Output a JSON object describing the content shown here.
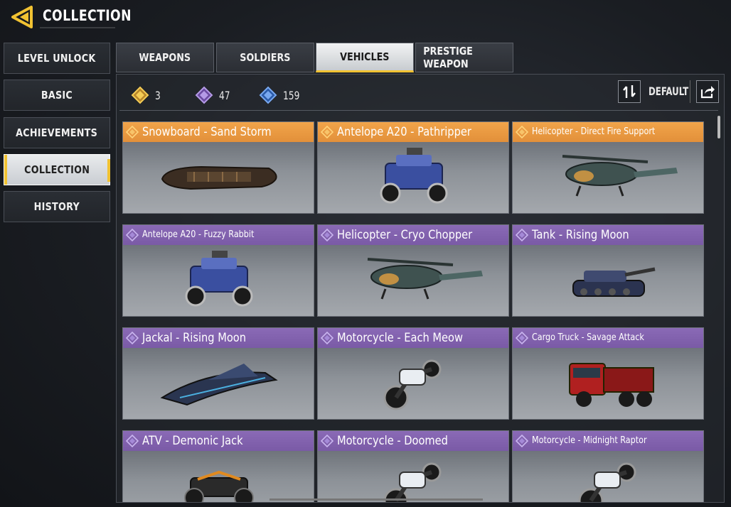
{
  "header": {
    "title": "COLLECTION"
  },
  "menu": [
    {
      "label": "LEVEL UNLOCK",
      "active": false
    },
    {
      "label": "BASIC",
      "active": false
    },
    {
      "label": "ACHIEVEMENTS",
      "active": false
    },
    {
      "label": "COLLECTION",
      "active": true
    },
    {
      "label": "HISTORY",
      "active": false
    }
  ],
  "tabs": [
    {
      "label": "WEAPONS",
      "active": false
    },
    {
      "label": "SOLDIERS",
      "active": false
    },
    {
      "label": "VEHICLES",
      "active": true
    },
    {
      "label": "PRESTIGE WEAPON",
      "active": false
    }
  ],
  "stats": {
    "legendary": {
      "value": "3",
      "color": "#e9b53a"
    },
    "epic": {
      "value": "47",
      "color": "#9b7ad8"
    },
    "rare": {
      "value": "159",
      "color": "#4d82d8"
    }
  },
  "sort": {
    "label": "DEFAULT"
  },
  "items": [
    {
      "name": "Snowboard - Sand Storm",
      "rarity": "legendary",
      "vehicle": "snowboard"
    },
    {
      "name": "Antelope A20 - Pathripper",
      "rarity": "legendary",
      "vehicle": "antelope"
    },
    {
      "name": "Helicopter - Direct Fire Support",
      "rarity": "legendary",
      "vehicle": "helicopter"
    },
    {
      "name": "Antelope A20 - Fuzzy Rabbit",
      "rarity": "epic",
      "vehicle": "antelope"
    },
    {
      "name": "Helicopter - Cryo Chopper",
      "rarity": "epic",
      "vehicle": "helicopter"
    },
    {
      "name": "Tank - Rising Moon",
      "rarity": "epic",
      "vehicle": "tank"
    },
    {
      "name": "Jackal - Rising Moon",
      "rarity": "epic",
      "vehicle": "jackal"
    },
    {
      "name": "Motorcycle - Each Meow",
      "rarity": "epic",
      "vehicle": "motorcycle"
    },
    {
      "name": "Cargo Truck - Savage Attack",
      "rarity": "epic",
      "vehicle": "truck"
    },
    {
      "name": "ATV - Demonic Jack",
      "rarity": "epic",
      "vehicle": "atv"
    },
    {
      "name": "Motorcycle - Doomed",
      "rarity": "epic",
      "vehicle": "motorcycle"
    },
    {
      "name": "Motorcycle - Midnight Raptor",
      "rarity": "epic",
      "vehicle": "motorcycle"
    }
  ]
}
